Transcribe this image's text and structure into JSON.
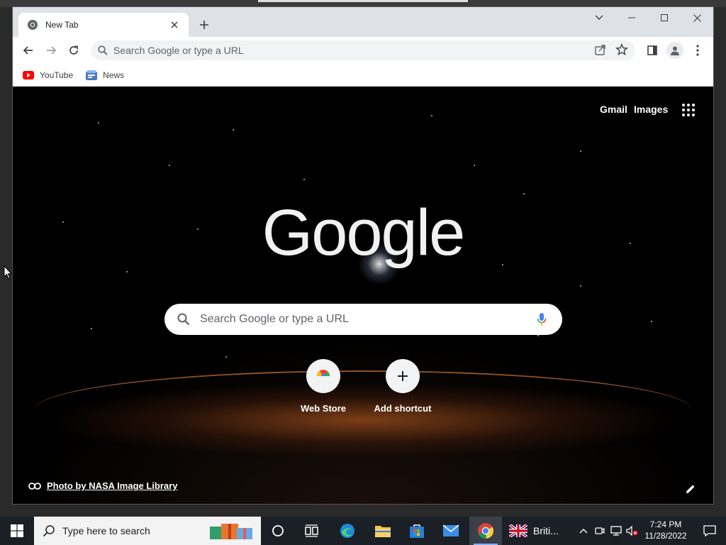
{
  "browser": {
    "tab": {
      "title": "New Tab"
    },
    "omnibox": {
      "placeholder": "Search Google or type a URL"
    },
    "bookmarks": [
      {
        "label": "YouTube",
        "icon": "youtube-icon"
      },
      {
        "label": "News",
        "icon": "news-icon"
      }
    ]
  },
  "ntp": {
    "links": {
      "gmail": "Gmail",
      "images": "Images"
    },
    "logo": "Google",
    "search": {
      "placeholder": "Search Google or type a URL"
    },
    "shortcuts": [
      {
        "label": "Web Store",
        "icon": "webstore-icon"
      },
      {
        "label": "Add shortcut",
        "icon": "plus-icon"
      }
    ],
    "photo_credit": "Photo by NASA Image Library"
  },
  "taskbar": {
    "search": {
      "placeholder": "Type here to search"
    },
    "language": "Briti...",
    "time": "7:24 PM",
    "date": "11/28/2022"
  },
  "colors": {
    "accent": "#1a73e8",
    "youtube_red": "#ff0000",
    "taskbar": "#1b1f26",
    "titlebar": "#dee1e6"
  }
}
